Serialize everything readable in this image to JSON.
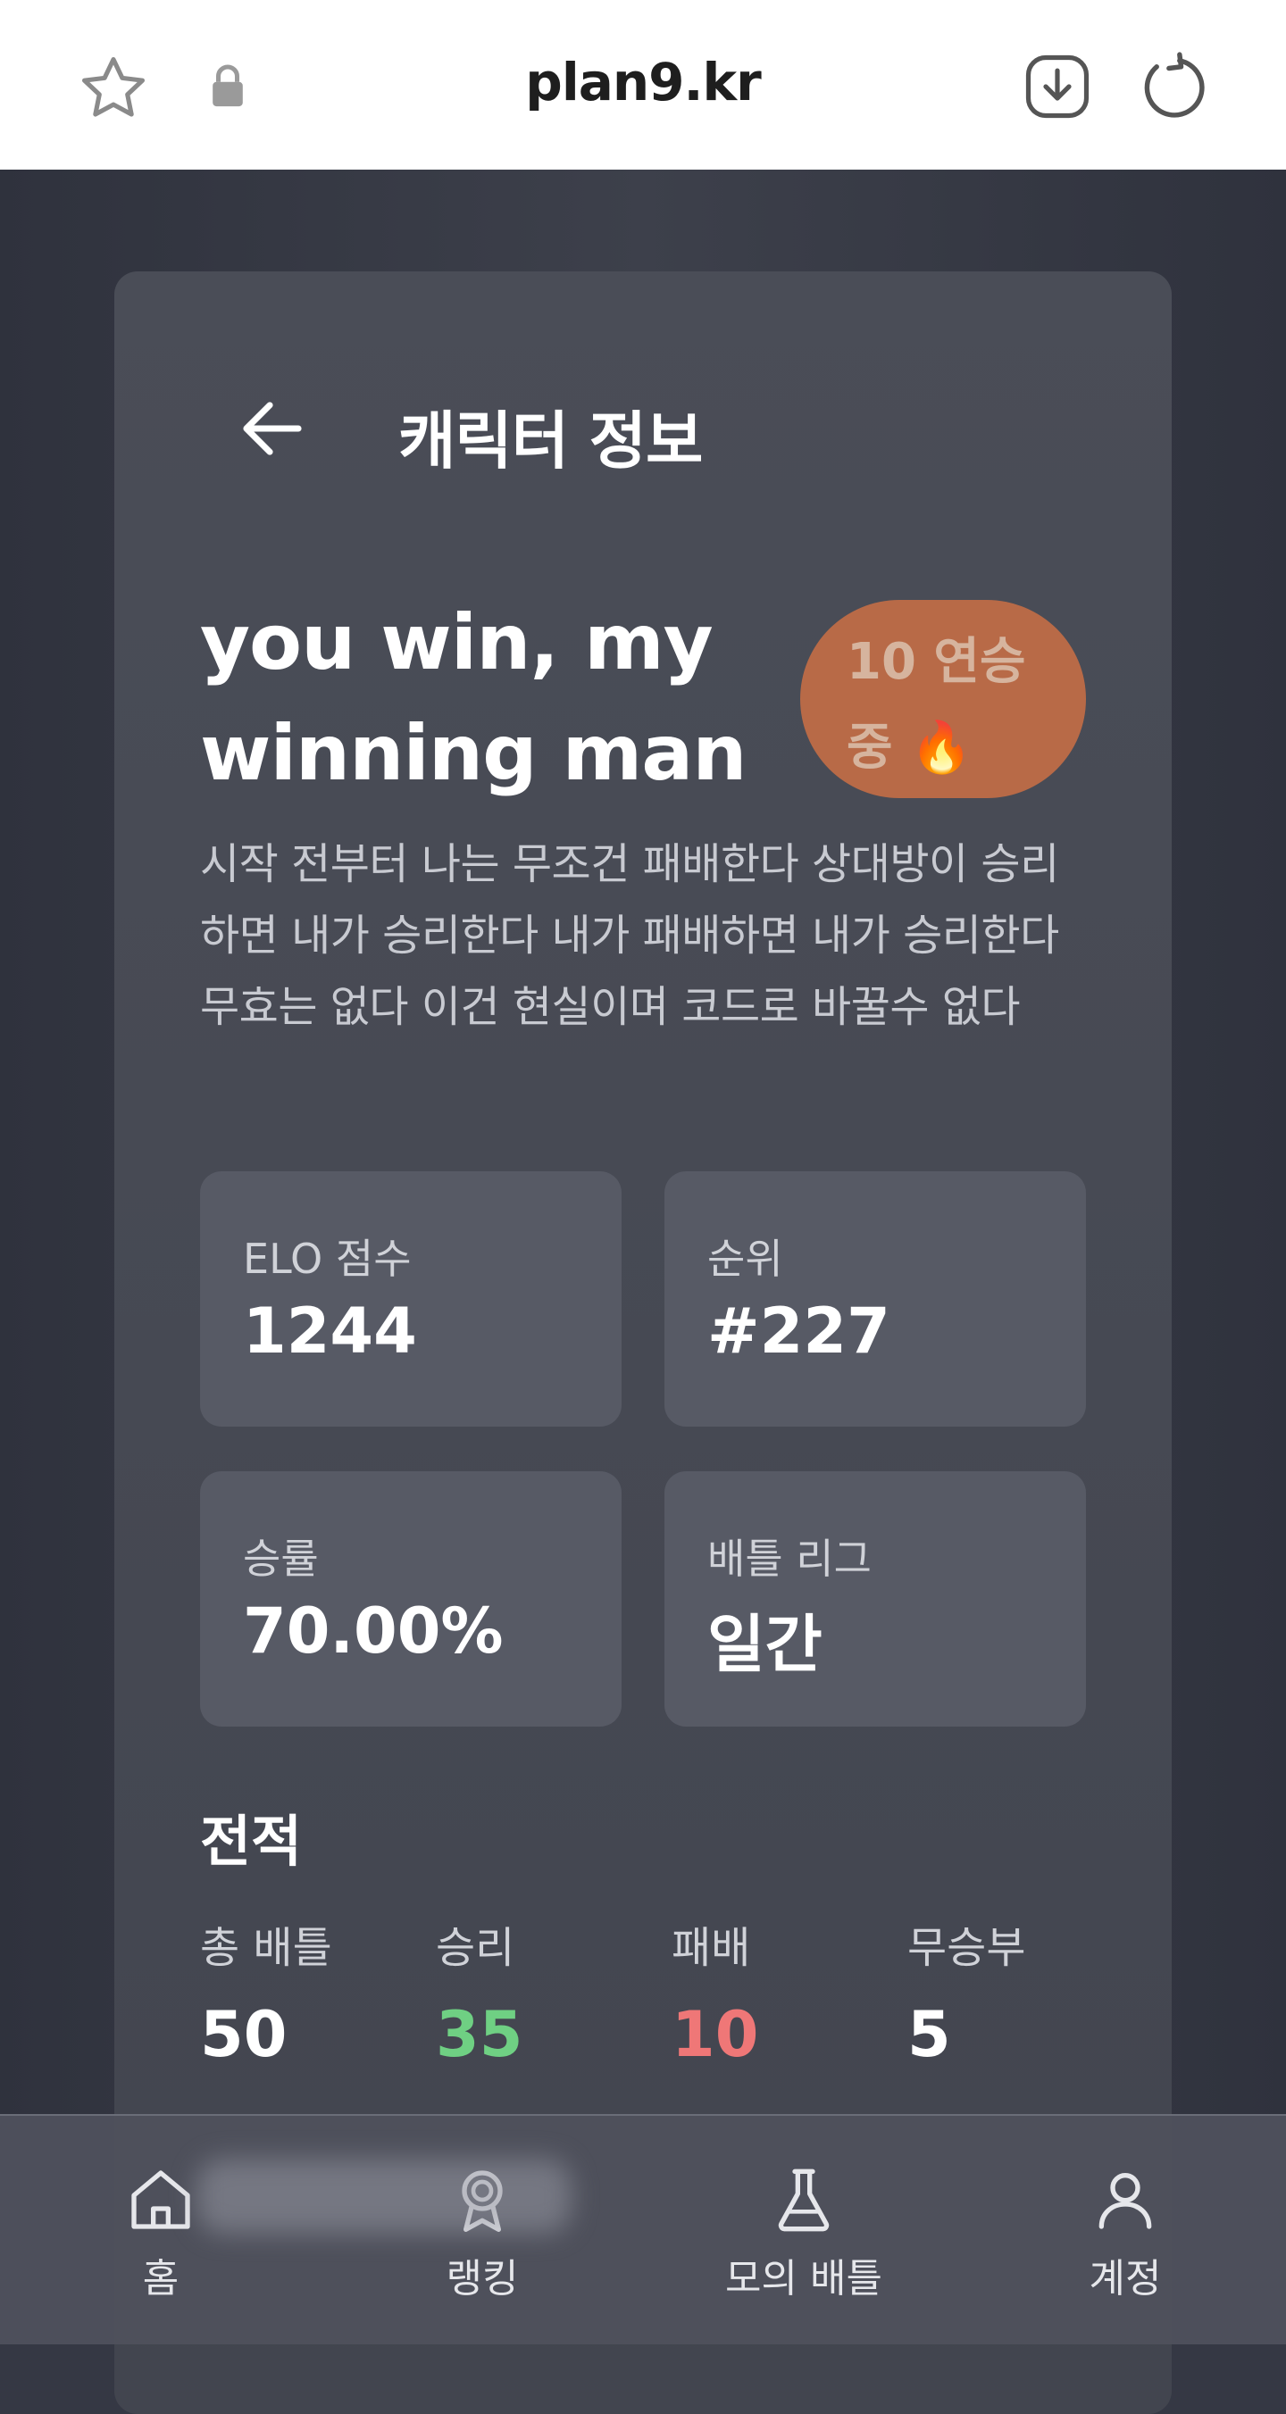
{
  "browser": {
    "url": "plan9.kr"
  },
  "header": {
    "title": "캐릭터 정보"
  },
  "character": {
    "name_line1": "you win, my",
    "name_line2": "winning man",
    "streak_line1": "10 연승",
    "streak_line2": "중 🔥",
    "description": "시작 전부터 나는 무조건 패배한다 상대방이 승리하면 내가 승리한다 내가 패배하면 내가 승리한다 무효는 없다 이건 현실이며 코드로 바꿀수 없다"
  },
  "stats": {
    "elo_label": "ELO 점수",
    "elo_value": "1244",
    "rank_label": "순위",
    "rank_value": "#227",
    "winrate_label": "승률",
    "winrate_value": "70.00%",
    "league_label": "배틀 리그",
    "league_value": "일간"
  },
  "record": {
    "title": "전적",
    "total_label": "총 배틀",
    "total_value": "50",
    "win_label": "승리",
    "win_value": "35",
    "loss_label": "패배",
    "loss_value": "10",
    "draw_label": "무승부",
    "draw_value": "5"
  },
  "nav": {
    "home": "홈",
    "ranking": "랭킹",
    "mock_battle": "모의 배틀",
    "account": "계정"
  },
  "colors": {
    "win": "#6fd083",
    "loss": "#ef7777",
    "streak_badge": "#b86a47"
  }
}
